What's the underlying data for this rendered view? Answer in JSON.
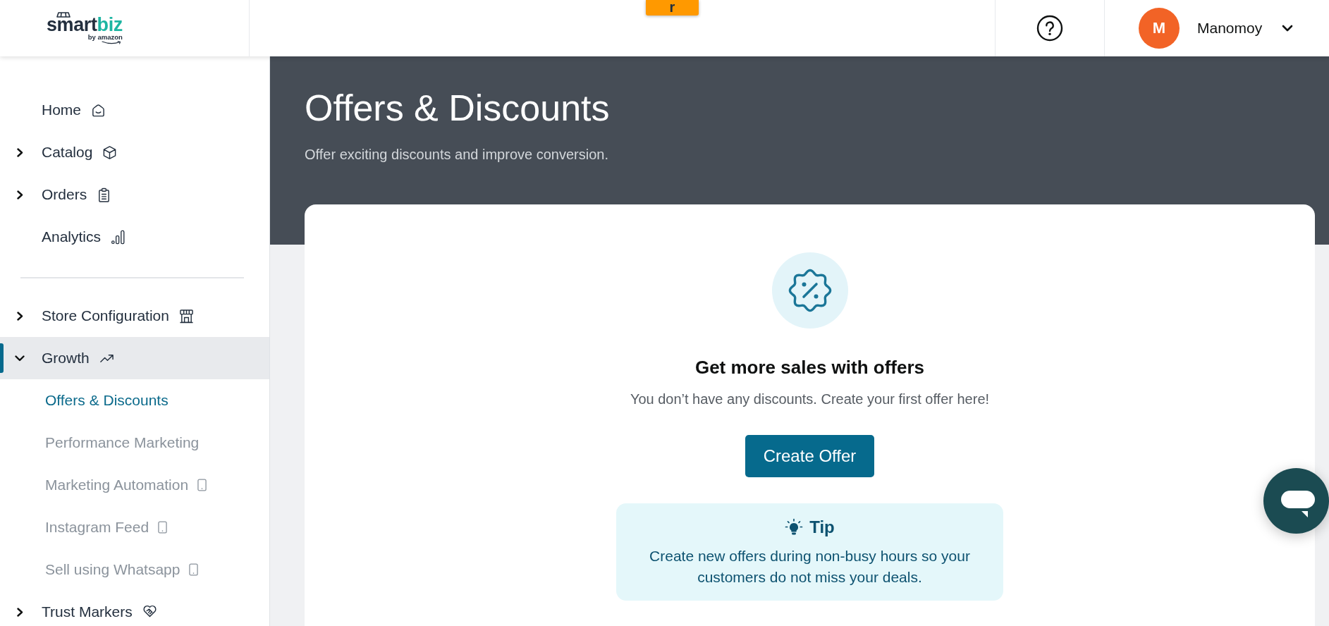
{
  "header": {
    "logo": {
      "wordmark": "smart",
      "wordmark_accent": "biz",
      "tagline": "by amazon"
    },
    "floating_tab": {
      "label": "r"
    },
    "user": {
      "initial": "M",
      "name": "Manomoy"
    }
  },
  "sidebar": {
    "sections": [
      {
        "items": [
          {
            "label": "Home",
            "kind": "link",
            "selected": false
          },
          {
            "label": "Catalog",
            "kind": "group",
            "expanded": false,
            "selected": false
          },
          {
            "label": "Orders",
            "kind": "group",
            "expanded": false,
            "selected": false
          },
          {
            "label": "Analytics",
            "kind": "link",
            "selected": false
          }
        ]
      },
      {
        "items": [
          {
            "label": "Store Configuration",
            "kind": "group",
            "expanded": false,
            "selected": false
          },
          {
            "label": "Growth",
            "kind": "group",
            "expanded": true,
            "selected": true,
            "children": [
              {
                "label": "Offers & Discounts",
                "selected": true,
                "mobile_badge": false
              },
              {
                "label": "Performance Marketing",
                "selected": false,
                "mobile_badge": false
              },
              {
                "label": "Marketing Automation",
                "selected": false,
                "mobile_badge": true
              },
              {
                "label": "Instagram Feed",
                "selected": false,
                "mobile_badge": true
              },
              {
                "label": "Sell using Whatsapp",
                "selected": false,
                "mobile_badge": true
              }
            ]
          },
          {
            "label": "Trust Markers",
            "kind": "group",
            "expanded": false,
            "selected": false
          }
        ]
      }
    ]
  },
  "page_header": {
    "title": "Offers & Discounts",
    "subtitle": "Offer exciting discounts and improve conversion."
  },
  "empty_state": {
    "heading": "Get more sales with offers",
    "message": "You don’t have any discounts. Create your first offer here!",
    "button": "Create Offer",
    "tip": {
      "title": "Tip",
      "text": "Create new offers during non-busy hours so your customers do not miss your deals."
    }
  }
}
